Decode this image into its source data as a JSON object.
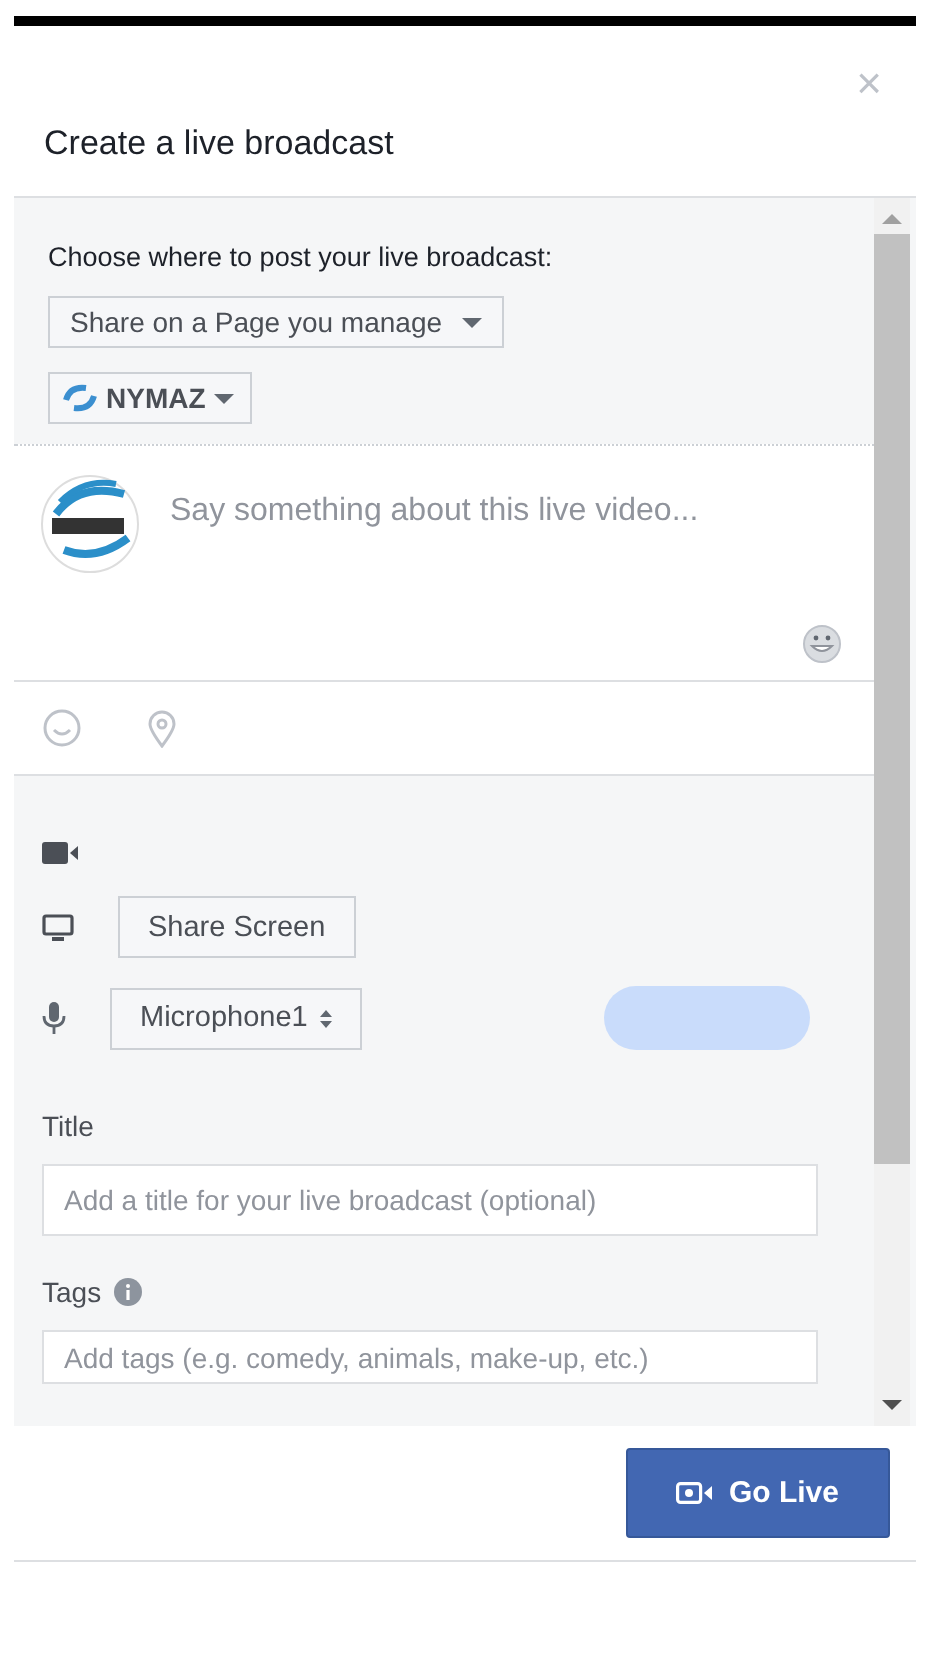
{
  "dialog": {
    "title": "Create a live broadcast",
    "close": "×"
  },
  "post_target": {
    "label": "Choose where to post your live broadcast:",
    "dropdown": "Share on a Page you manage",
    "page_button": "NYMAZ"
  },
  "composer": {
    "placeholder": "Say something about this live video..."
  },
  "sources": [
    {
      "kind": "camera"
    },
    {
      "kind": "screen",
      "button": "Share Screen"
    },
    {
      "kind": "microphone",
      "select": "Microphone1"
    }
  ],
  "title_field": {
    "label": "Title",
    "placeholder": "Add a title for your live broadcast (optional)"
  },
  "tags_field": {
    "label": "Tags",
    "placeholder": "Add tags (e.g. comedy, animals, make-up, etc.)"
  },
  "footer": {
    "button": "Go Live"
  }
}
